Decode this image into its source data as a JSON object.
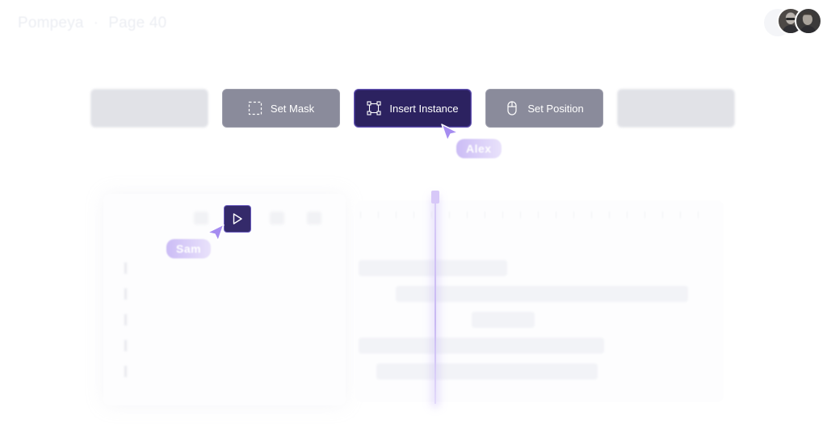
{
  "header": {
    "breadcrumb": [
      "Pompeya",
      "Page 40"
    ],
    "breadcrumb_separator": "·"
  },
  "toolbar": {
    "tools": [
      {
        "label": "Set Mask",
        "icon": "dashed-square-icon",
        "state": "enabled"
      },
      {
        "label": "Insert Instance",
        "icon": "transform-frame-icon",
        "state": "active"
      },
      {
        "label": "Set Position",
        "icon": "mouse-icon",
        "state": "enabled"
      }
    ]
  },
  "collaborators": {
    "cursor_1": {
      "name": "Alex",
      "color": "#a58cf0"
    },
    "cursor_2": {
      "name": "Sam",
      "color": "#a58cf0"
    }
  },
  "colors": {
    "accent_active": "#2c2260",
    "accent_border": "#6656b5",
    "tool_gray": "#8a8b9b",
    "playhead": "#c9b9f3"
  }
}
